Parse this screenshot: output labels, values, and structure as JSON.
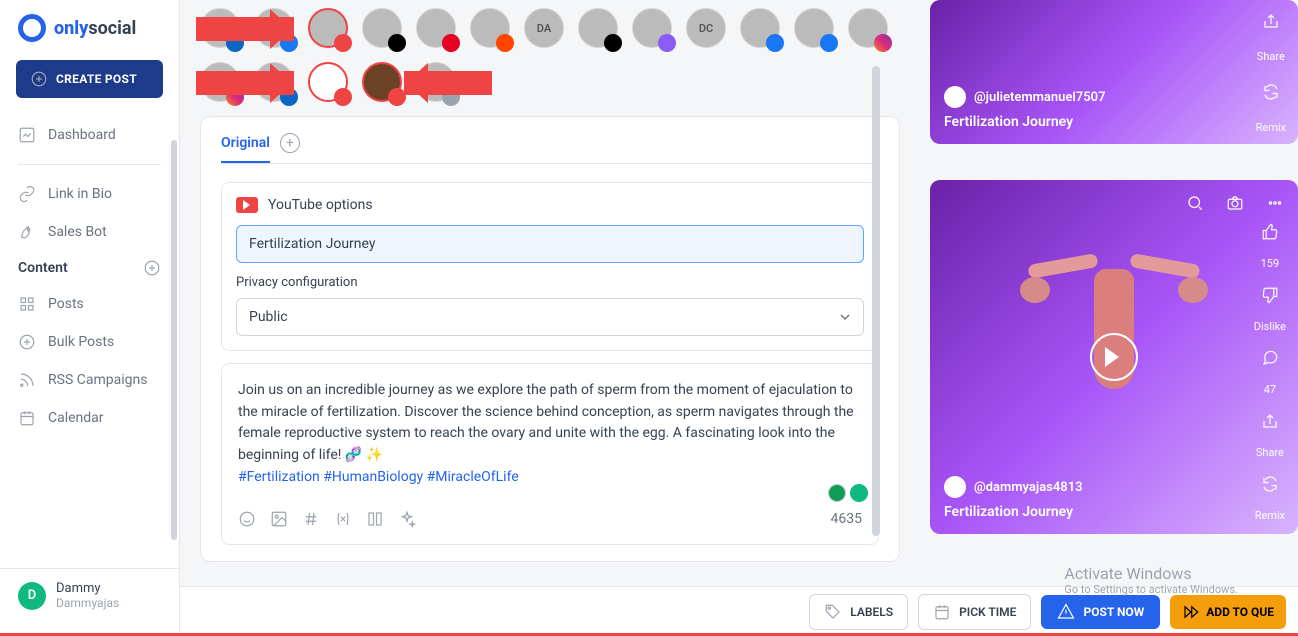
{
  "brand": {
    "name_bold": "only",
    "name_rest": "social"
  },
  "sidebar": {
    "create_label": "CREATE POST",
    "items": [
      "Dashboard",
      "Link in Bio",
      "Sales Bot"
    ],
    "content_head": "Content",
    "content_items": [
      "Posts",
      "Bulk Posts",
      "RSS Campaigns",
      "Calendar"
    ]
  },
  "user": {
    "initial": "D",
    "name": "Dammy",
    "handle": "Dammyajas"
  },
  "accounts_row1": [
    {
      "badge": "li"
    },
    {
      "badge": "fb"
    },
    {
      "badge": "yt",
      "selected": true
    },
    {
      "badge": "tk"
    },
    {
      "badge": "pi"
    },
    {
      "badge": "rd"
    },
    {
      "badge": "",
      "label": "DA"
    },
    {
      "badge": "tb"
    },
    {
      "badge": "tw"
    },
    {
      "badge": "",
      "label": "DC"
    },
    {
      "badge": "fb"
    },
    {
      "badge": "fb"
    },
    {
      "badge": "ig"
    }
  ],
  "accounts_row2": [
    {
      "badge": "ig"
    },
    {
      "badge": "li"
    },
    {
      "badge": "yt",
      "selected": true
    },
    {
      "badge": "yt",
      "selected": true
    },
    {
      "badge": "tg"
    }
  ],
  "tabs": {
    "active": "Original"
  },
  "youtube": {
    "heading": "YouTube options",
    "title_value": "Fertilization Journey",
    "privacy_label": "Privacy configuration",
    "privacy_value": "Public"
  },
  "description": {
    "body": "Join us on an incredible journey as we explore the path of sperm from the moment of ejaculation to the miracle of fertilization. Discover the science behind conception, as sperm navigates through the female reproductive system to reach the ovary and unite with the egg. A fascinating look into the beginning of life! 🧬 ✨",
    "tags": "#Fertilization #HumanBiology #MiracleOfLife",
    "char_count": "4635"
  },
  "preview": {
    "card1": {
      "handle": "@julietemmanuel7507",
      "title": "Fertilization Journey",
      "actions": [
        "Share",
        "Remix"
      ]
    },
    "card2": {
      "handle": "@dammyajas4813",
      "title": "Fertilization Journey",
      "likes": "159",
      "dislike": "Dislike",
      "comments": "47",
      "share": "Share",
      "remix": "Remix"
    }
  },
  "bottom": {
    "labels": "LABELS",
    "pick_time": "PICK TIME",
    "post_now": "POST NOW",
    "add_queue": "ADD TO QUE"
  },
  "watermark": {
    "line1": "Activate Windows",
    "line2": "Go to Settings to activate Windows."
  }
}
